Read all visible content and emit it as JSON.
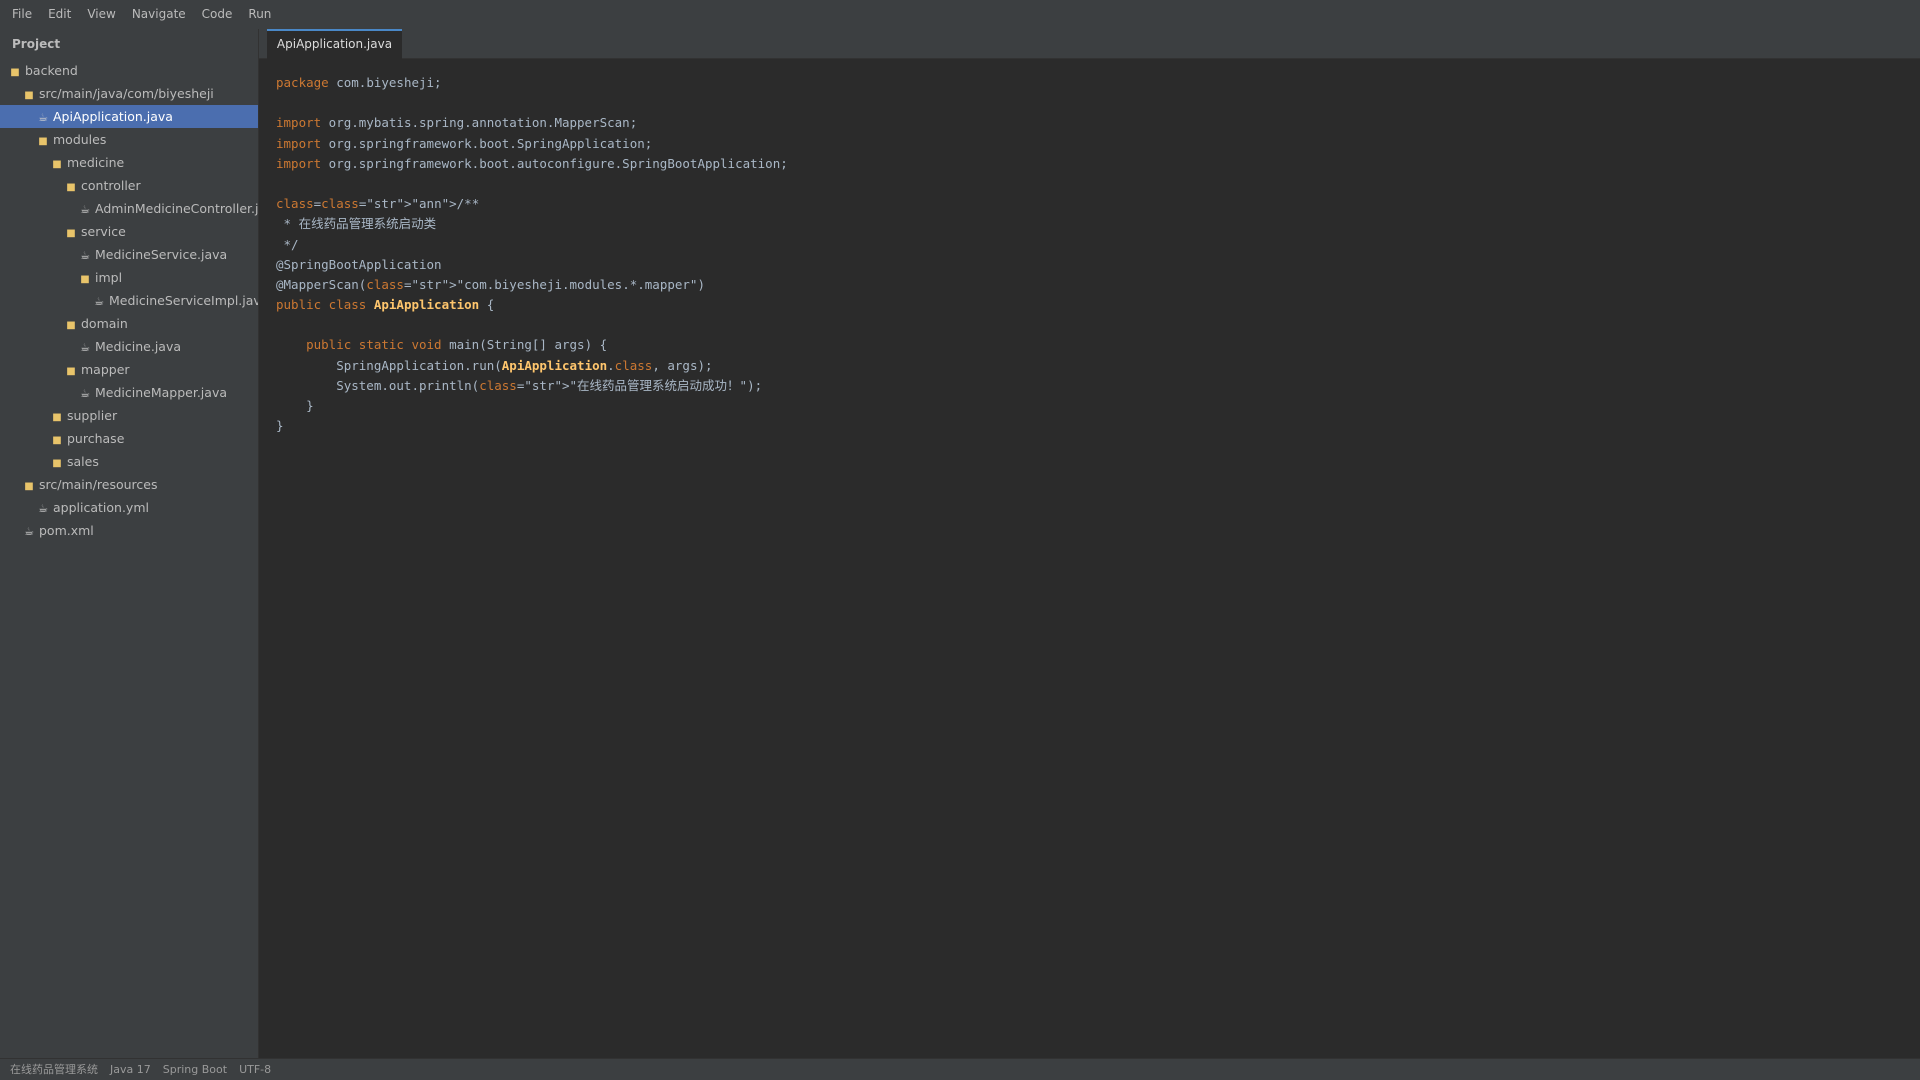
{
  "menu": [
    "File",
    "Edit",
    "View",
    "Navigate",
    "Code",
    "Run"
  ],
  "sidebar": {
    "title": "Project",
    "tree": [
      {
        "label": "backend",
        "type": "folder",
        "depth": 0
      },
      {
        "label": "src/main/java/com/biyesheji",
        "type": "folder",
        "depth": 1
      },
      {
        "label": "ApiApplication.java",
        "type": "file",
        "depth": 2,
        "selected": true
      },
      {
        "label": "modules",
        "type": "folder",
        "depth": 2
      },
      {
        "label": "medicine",
        "type": "folder",
        "depth": 3
      },
      {
        "label": "controller",
        "type": "folder",
        "depth": 4
      },
      {
        "label": "AdminMedicineController.java",
        "type": "file",
        "depth": 5
      },
      {
        "label": "service",
        "type": "folder",
        "depth": 4
      },
      {
        "label": "MedicineService.java",
        "type": "file",
        "depth": 5
      },
      {
        "label": "impl",
        "type": "folder",
        "depth": 5
      },
      {
        "label": "MedicineServiceImpl.java",
        "type": "file",
        "depth": 6
      },
      {
        "label": "domain",
        "type": "folder",
        "depth": 4
      },
      {
        "label": "Medicine.java",
        "type": "file",
        "depth": 5
      },
      {
        "label": "mapper",
        "type": "folder",
        "depth": 4
      },
      {
        "label": "MedicineMapper.java",
        "type": "file",
        "depth": 5
      },
      {
        "label": "supplier",
        "type": "folder",
        "depth": 3
      },
      {
        "label": "purchase",
        "type": "folder",
        "depth": 3
      },
      {
        "label": "sales",
        "type": "folder",
        "depth": 3
      },
      {
        "label": "src/main/resources",
        "type": "folder",
        "depth": 1
      },
      {
        "label": "application.yml",
        "type": "file",
        "depth": 2
      },
      {
        "label": "pom.xml",
        "type": "file",
        "depth": 1
      }
    ]
  },
  "tabs": [
    {
      "label": "ApiApplication.java",
      "active": true
    }
  ],
  "code": [
    [
      {
        "t": "package",
        "c": "kw"
      },
      {
        "t": " com.biyesheji;"
      }
    ],
    [],
    [
      {
        "t": "import",
        "c": "kw"
      },
      {
        "t": " org.mybatis.spring.annotation.MapperScan;"
      }
    ],
    [
      {
        "t": "import",
        "c": "kw"
      },
      {
        "t": " org.springframework.boot.SpringApplication;"
      }
    ],
    [
      {
        "t": "import",
        "c": "kw"
      },
      {
        "t": " org.springframework.boot.autoconfigure.SpringBootApplication;"
      }
    ],
    [],
    [
      {
        "t": "class",
        "c": "kw"
      },
      {
        "t": "="
      },
      {
        "t": "class",
        "c": "kw"
      },
      {
        "t": "=\"str\">\"ann\">/**"
      }
    ],
    [
      {
        "t": " * 在线药品管理系统启动类"
      }
    ],
    [
      {
        "t": " */"
      }
    ],
    [
      {
        "t": "@SpringBootApplication"
      }
    ],
    [
      {
        "t": "@MapperScan("
      },
      {
        "t": "class",
        "c": "kw"
      },
      {
        "t": "=\"str\">\"com.biyesheji.modules.*.mapper\")"
      }
    ],
    [
      {
        "t": "public class ",
        "c": "kw"
      },
      {
        "t": "ApiApplication",
        "c": "cls"
      },
      {
        "t": " {"
      }
    ],
    [],
    [
      {
        "t": "    "
      },
      {
        "t": "public static void",
        "c": "kw"
      },
      {
        "t": " main(String[] args) {"
      }
    ],
    [
      {
        "t": "        SpringApplication.run("
      },
      {
        "t": "ApiApplication",
        "c": "cls"
      },
      {
        "t": "."
      },
      {
        "t": "class",
        "c": "kw"
      },
      {
        "t": ", args);"
      }
    ],
    [
      {
        "t": "        System.out.println("
      },
      {
        "t": "class",
        "c": "kw"
      },
      {
        "t": "=\"str\">\"在线药品管理系统启动成功！\");"
      }
    ],
    [
      {
        "t": "    }"
      }
    ],
    [
      {
        "t": "}"
      }
    ]
  ],
  "statusbar": [
    "在线药品管理系统",
    "Java 17",
    "Spring Boot",
    "UTF-8"
  ],
  "colors": {
    "background": "#2b2b2b",
    "panel": "#3c3f41",
    "selection": "#4b6eaf",
    "keyword": "#cc7832",
    "class_name": "#ffc66d",
    "text": "#a9b7c6"
  }
}
